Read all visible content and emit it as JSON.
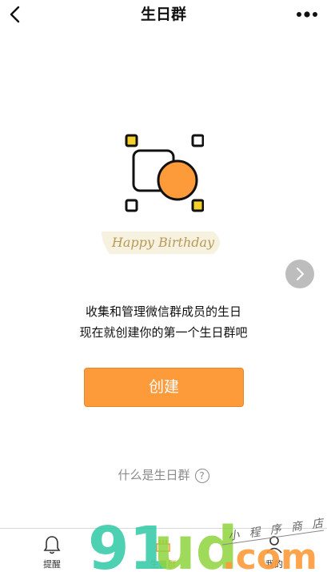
{
  "header": {
    "title": "生日群",
    "back_icon": "back-arrow-icon",
    "more_icon": "more-dots-icon"
  },
  "illustration": {
    "banner_text": "Happy Birthday",
    "accent": "#fd9a3a",
    "marker_yellow": "#f6d02a"
  },
  "description": {
    "line1": "收集和管理微信群成员的生日",
    "line2": "现在就创建你的第一个生日群吧"
  },
  "create_button": {
    "label": "创建",
    "color": "#fd9a3a"
  },
  "help": {
    "label": "什么是生日群",
    "icon": "question-circle-icon"
  },
  "tabs": [
    {
      "label": "提醒",
      "icon": "bell-icon"
    },
    {
      "label": "生日群",
      "icon": "cake-icon",
      "active": true
    },
    {
      "label": "我的",
      "icon": "person-icon"
    }
  ],
  "watermark": {
    "text": "91ud.com",
    "small_text": "小程序商店"
  }
}
